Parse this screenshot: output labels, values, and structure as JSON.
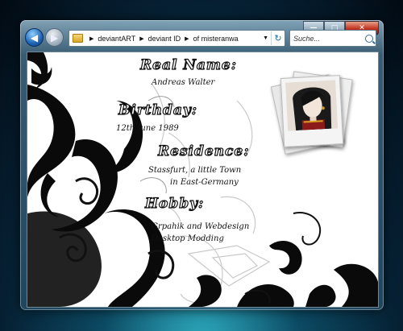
{
  "explorer": {
    "breadcrumbs": [
      "deviantART",
      "deviant ID",
      "of misteranwa"
    ],
    "search_placeholder": "Suche..."
  },
  "profile": {
    "real_name_heading": "Real Name:",
    "real_name": "Andreas Walter",
    "birthday_heading": "Birthday:",
    "birthday": "12th June 1989",
    "residence_heading": "Residence:",
    "residence_line1": "Stassfurt, a little Town",
    "residence_line2": "in East-Germany",
    "hobby_heading": "Hobby:",
    "hobby_line1": "Grpahik and Webdesign",
    "hobby_line2": "Desktop Modding"
  }
}
